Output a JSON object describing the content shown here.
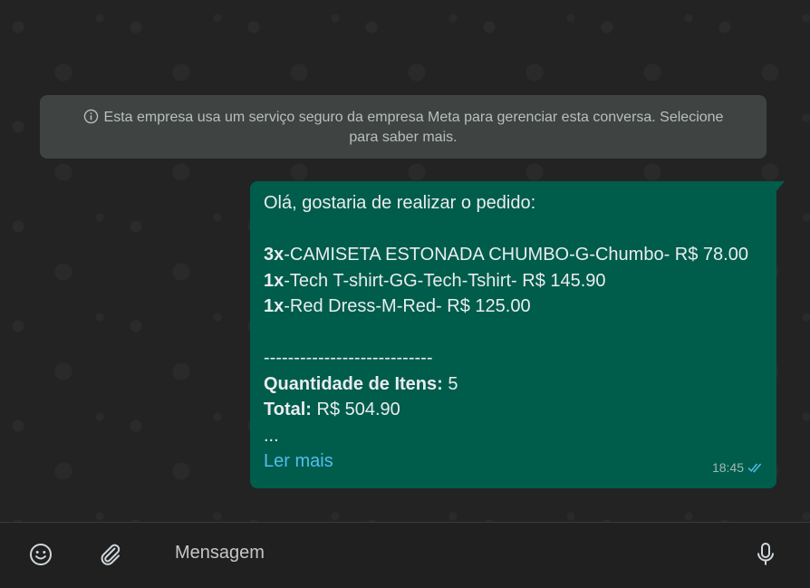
{
  "notice": {
    "text_line1": "Esta empresa usa um serviço seguro da empresa Meta para gerenciar esta conversa. Selecione",
    "text_line2": "para saber mais.",
    "icon": "info-icon"
  },
  "message": {
    "greeting": "Olá, gostaria de realizar o pedido:",
    "items": [
      {
        "qty": "3x",
        "desc": "-CAMISETA ESTONADA CHUMBO-G-Chumbo- R$ 78.00"
      },
      {
        "qty": "1x",
        "desc": "-Tech T-shirt-GG-Tech-Tshirt- R$ 145.90"
      },
      {
        "qty": "1x",
        "desc": "-Red Dress-M-Red- R$ 125.00"
      }
    ],
    "separator": "----------------------------",
    "quantity_label": "Quantidade de Itens:",
    "quantity_value": " 5",
    "total_label": "Total:",
    "total_value": " R$ 504.90",
    "ellipsis": "...",
    "read_more": "Ler mais",
    "time": "18:45",
    "status_icon": "double-check-icon",
    "colors": {
      "bubble": "#005c4b",
      "link": "#53bdeb",
      "read_ticks": "#53bdeb"
    }
  },
  "composer": {
    "placeholder": "Mensagem",
    "emoji_icon": "emoji-icon",
    "attach_icon": "paperclip-icon",
    "mic_icon": "microphone-icon"
  }
}
